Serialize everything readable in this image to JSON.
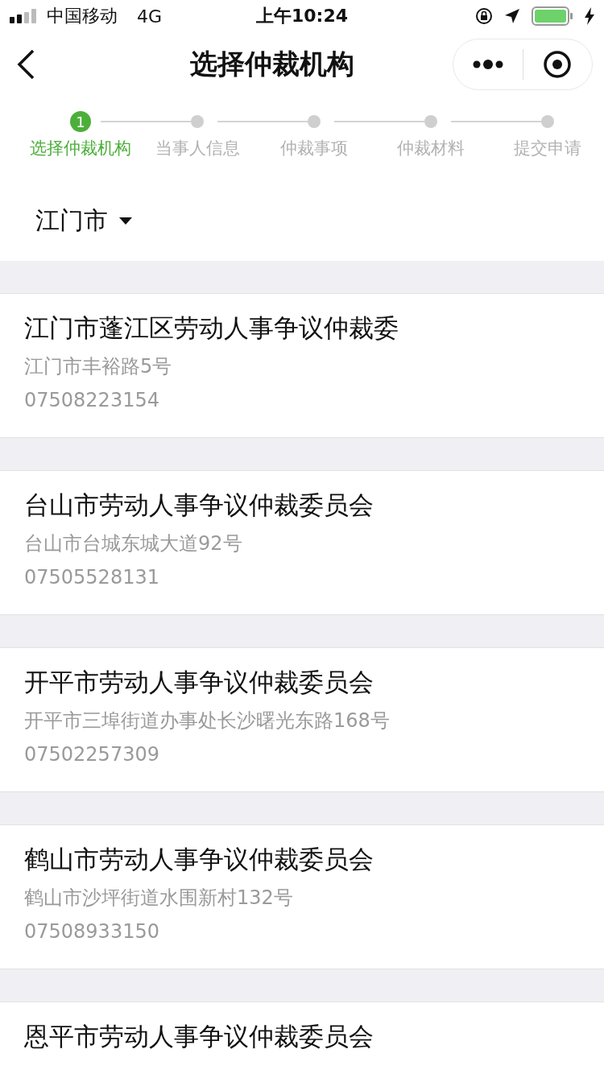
{
  "status_bar": {
    "carrier": "中国移动",
    "network": "4G",
    "time": "上午10:24"
  },
  "nav": {
    "title": "选择仲裁机构"
  },
  "steps": [
    {
      "number": "1",
      "label": "选择仲裁机构",
      "selected": true
    },
    {
      "label": "当事人信息",
      "selected": false
    },
    {
      "label": "仲裁事项",
      "selected": false
    },
    {
      "label": "仲裁材料",
      "selected": false
    },
    {
      "label": "提交申请",
      "selected": false
    }
  ],
  "city": "江门市",
  "institutions": [
    {
      "name": "江门市蓬江区劳动人事争议仲裁委",
      "address": "江门市丰裕路5号",
      "phone": "07508223154"
    },
    {
      "name": "台山市劳动人事争议仲裁委员会",
      "address": "台山市台城东城大道92号",
      "phone": "07505528131"
    },
    {
      "name": "开平市劳动人事争议仲裁委员会",
      "address": "开平市三埠街道办事处长沙曙光东路168号",
      "phone": "07502257309"
    },
    {
      "name": "鹤山市劳动人事争议仲裁委员会",
      "address": "鹤山市沙坪街道水围新村132号",
      "phone": "07508933150"
    },
    {
      "name": "恩平市劳动人事争议仲裁委员会"
    }
  ]
}
